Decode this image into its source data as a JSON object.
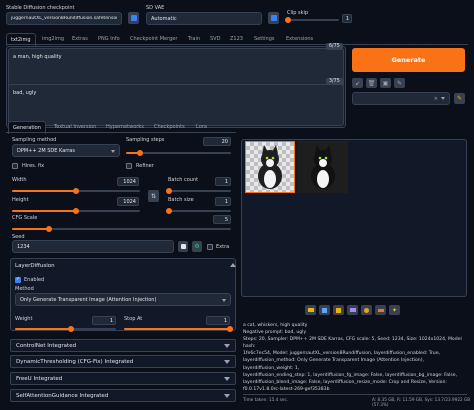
{
  "top": {
    "checkpoint_label": "Stable Diffusion checkpoint",
    "checkpoint_value": "juggernautXL_version8Rundiffusion.safetensors",
    "vae_label": "SD VAE",
    "vae_value": "Automatic",
    "clip_skip_label": "Clip skip",
    "clip_skip_value": 1
  },
  "main_tabs": [
    "txt2img",
    "img2img",
    "Extras",
    "PNG Info",
    "Checkpoint Merger",
    "Train",
    "SVD",
    "Z123",
    "Settings",
    "Extensions"
  ],
  "prompt": {
    "positive": "a man, high quality",
    "positive_count": "6/75",
    "negative": "bad, ugly",
    "negative_count": "3/75"
  },
  "generate_label": "Generate",
  "sub_tabs": [
    "Generation",
    "Textual Inversion",
    "Hypernetworks",
    "Checkpoints",
    "Lora"
  ],
  "gen": {
    "sampling_method_label": "Sampling method",
    "sampling_method": "DPM++ 2M SDE Karras",
    "sampling_steps_label": "Sampling steps",
    "sampling_steps": "20",
    "steps_fill": 0.13,
    "hires_label": "Hires. fix",
    "refiner_label": "Refiner",
    "width_label": "Width",
    "width": "1024",
    "width_fill": 0.5,
    "height_label": "Height",
    "height": "1024",
    "height_fill": 0.5,
    "batch_count_label": "Batch count",
    "batch_count": "1",
    "batch_size_label": "Batch size",
    "batch_size": "1",
    "cfg_label": "CFG Scale",
    "cfg": "5",
    "cfg_fill": 0.17,
    "seed_label": "Seed",
    "seed": "1234",
    "extra_label": "Extra"
  },
  "layer_diffusion": {
    "title": "LayerDiffusion",
    "enabled_label": "Enabled",
    "method_label": "Method",
    "method_value": "Only Generate Transparent Image (Attention Injection)",
    "weight_label": "Weight",
    "weight_value": "1",
    "weight_fill": 0.55,
    "stop_label": "Stop At",
    "stop_value": "1",
    "stop_fill": 1.0
  },
  "accordions": [
    "ControlNet Integrated",
    "DynamicThresholding (CFG-Fix) Integrated",
    "FreeU Integrated",
    "SelfAttentionGuidance Integrated"
  ],
  "output": {
    "info_lines": [
      "a cat, whiskers, high quality",
      "Negative prompt: bad, ugly",
      "Steps: 20, Sampler: DPM++ 2M SDE Karras, CFG scale: 5, Seed: 1234, Size: 1024x1024, Model hash:",
      "1fe6c7ec54, Model: juggernautXL_version8Rundiffusion, layerdiffusion_enabled: True,",
      "layerdiffusion_method: Only Generate Transparent Image (Attention Injection), layerdiffusion_weight: 1,",
      "layerdiffusion_ending_step: 1, layerdiffusion_fg_image: False, layerdiffusion_bg_image: False,",
      "layerdiffusion_blend_image: False, layerdiffusion_resize_mode: Crop and Resize, Version:",
      "f0.0.17v1.8.0rc-latest-269-gef35383b"
    ],
    "time_taken": "Time taken: 15.4 sec.",
    "vram": "A: 8.35 GB, R: 11.59 GB, Sys: 13.7/23.9922 GB (57.3%)"
  },
  "colors": {
    "accent": "#f97316",
    "bg": "#0b0f19",
    "panel": "#111827"
  }
}
